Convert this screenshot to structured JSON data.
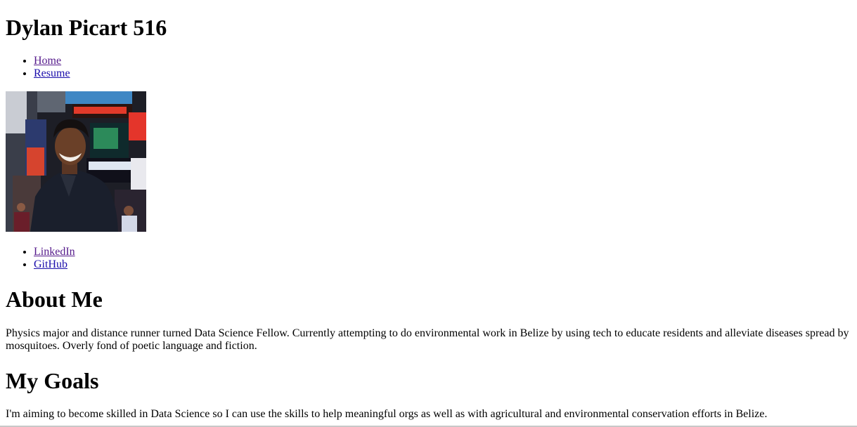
{
  "header": {
    "title": "Dylan Picart 516"
  },
  "primary_nav": {
    "items": [
      {
        "label": "Home"
      },
      {
        "label": "Resume"
      }
    ]
  },
  "profile": {
    "photo_icon": "profile-photo"
  },
  "social_nav": {
    "items": [
      {
        "label": "LinkedIn"
      },
      {
        "label": "GitHub"
      }
    ]
  },
  "about": {
    "heading": "About Me",
    "body": "Physics major and distance runner turned Data Science Fellow. Currently attempting to do environmental work in Belize by using tech to educate residents and alleviate diseases spread by mosquitoes. Overly fond of poetic language and fiction."
  },
  "goals": {
    "heading": "My Goals",
    "body": "I'm aiming to become skilled in Data Science so I can use the skills to help meaningful orgs as well as with agricultural and environmental conservation efforts in Belize."
  },
  "colors": {
    "link": "#1a0dab",
    "visited_link": "#551a8b",
    "text": "#000000",
    "background": "#ffffff"
  }
}
